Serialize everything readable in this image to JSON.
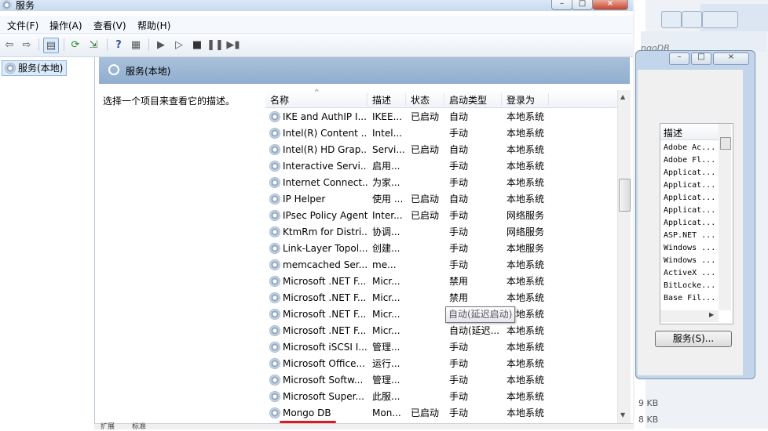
{
  "window": {
    "title": "服务"
  },
  "menu": [
    "文件(F)",
    "操作(A)",
    "查看(V)",
    "帮助(H)"
  ],
  "tree": {
    "root": "服务(本地)"
  },
  "header": {
    "title": "服务(本地)"
  },
  "description": {
    "hint": "选择一个项目来查看它的描述。"
  },
  "columns": [
    "名称",
    "描述",
    "状态",
    "启动类型",
    "登录为"
  ],
  "rows": [
    [
      "IKE and AuthIP I...",
      "IKEE...",
      "已启动",
      "自动",
      "本地系统"
    ],
    [
      "Intel(R) Content ...",
      "Intel...",
      "",
      "手动",
      "本地系统"
    ],
    [
      "Intel(R) HD Grap...",
      "Servi...",
      "已启动",
      "自动",
      "本地系统"
    ],
    [
      "Interactive Servi...",
      "启用...",
      "",
      "手动",
      "本地系统"
    ],
    [
      "Internet Connect...",
      "为家...",
      "",
      "手动",
      "本地系统"
    ],
    [
      "IP Helper",
      "使用 ...",
      "已启动",
      "自动",
      "本地系统"
    ],
    [
      "IPsec Policy Agent",
      "Inter...",
      "已启动",
      "手动",
      "网络服务"
    ],
    [
      "KtmRm for Distri...",
      "协调...",
      "",
      "手动",
      "网络服务"
    ],
    [
      "Link-Layer Topol...",
      "创建...",
      "",
      "手动",
      "本地服务"
    ],
    [
      "memcached Ser...",
      "me...",
      "",
      "手动",
      "本地系统"
    ],
    [
      "Microsoft .NET F...",
      "Micr...",
      "",
      "禁用",
      "本地系统"
    ],
    [
      "Microsoft .NET F...",
      "Micr...",
      "",
      "禁用",
      "本地系统"
    ],
    [
      "Microsoft .NET F...",
      "Micr...",
      "",
      "自动(延迟启动)",
      "本地系统"
    ],
    [
      "Microsoft .NET F...",
      "Micr...",
      "",
      "自动(延迟...",
      "本地系统"
    ],
    [
      "Microsoft iSCSI I...",
      "管理...",
      "",
      "手动",
      "本地系统"
    ],
    [
      "Microsoft Office...",
      "运行...",
      "",
      "手动",
      "本地系统"
    ],
    [
      "Microsoft Softw...",
      "管理...",
      "",
      "手动",
      "本地系统"
    ],
    [
      "Microsoft Super...",
      "此服...",
      "",
      "手动",
      "本地系统"
    ],
    [
      "Mongo DB",
      "Mon...",
      "已启动",
      "手动",
      "本地系统"
    ]
  ],
  "tooltip": "自动(延迟启动)",
  "bottom_tabs": [
    "扩展",
    "标准"
  ],
  "background": {
    "path_hint": "ngoDB",
    "dialog_col": "描述",
    "dialog_items": [
      "Adobe Ac...",
      "Adobe Fl...",
      "Applicat...",
      "Applicat...",
      "Applicat...",
      "Applicat...",
      "Applicat...",
      "ASP.NET ...",
      "Windows ...",
      "Windows ...",
      "ActiveX ...",
      "BitLocke...",
      "Base Fil..."
    ],
    "services_button": "服务(S)...",
    "sizes": [
      "9 KB",
      "8 KB"
    ]
  }
}
